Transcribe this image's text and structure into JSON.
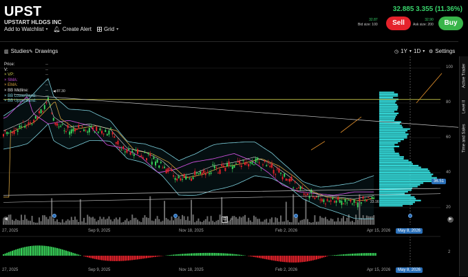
{
  "header": {
    "ticker": "UPST",
    "company": "UPSTART HLDGS INC",
    "add_watchlist": "Add to Watchlist",
    "create_alert": "Create Alert",
    "grid": "Grid",
    "quote": "32.885 3.355 (11.36%)",
    "bid_price": "32.87",
    "bid_size": "Bid size: 100",
    "ask_price": "32.90",
    "ask_size": "Ask size: 200",
    "sell": "Sell",
    "buy": "Buy"
  },
  "controls": {
    "studies": "Studies",
    "drawings": "Drawings",
    "range": "1Y",
    "interval": "1D",
    "settings": "Settings"
  },
  "side_tabs": [
    "Active Trader",
    "Level II",
    "Time and Sales"
  ],
  "legend": [
    {
      "label": "Price:",
      "value": "--",
      "color": "#e6e6e6"
    },
    {
      "label": "V:",
      "value": "--",
      "color": "#e6e6e6"
    },
    {
      "label": "VP:",
      "value": "--",
      "color": "#c9c94a"
    },
    {
      "label": "SMA:",
      "value": "--",
      "color": "#c84fd8"
    },
    {
      "label": "EMA:",
      "value": "--",
      "color": "#d9a540"
    },
    {
      "label": "BB Midline:",
      "value": "--",
      "color": "#e6e6e6"
    },
    {
      "label": "BB LowerBand:",
      "value": "--",
      "color": "#7fd3e0"
    },
    {
      "label": "BB UpperBand:",
      "value": "--",
      "color": "#7fd3e0"
    }
  ],
  "annotations": {
    "high": "87.30",
    "low": "23.16"
  },
  "price_tag": "36.51",
  "date_tag": "May 8, 2026",
  "y_ticks": [
    "100",
    "80",
    "60",
    "40",
    "20"
  ],
  "x_ticks": [
    "27, 2025",
    "Sep 9, 2025",
    "Nov 18, 2025",
    "Feb 2, 2026",
    "Apr 15, 2026"
  ],
  "osc_ticks": [
    "2"
  ],
  "colors": {
    "up": "#39d35a",
    "down": "#e5222b",
    "accent": "#2a6fb8"
  }
}
